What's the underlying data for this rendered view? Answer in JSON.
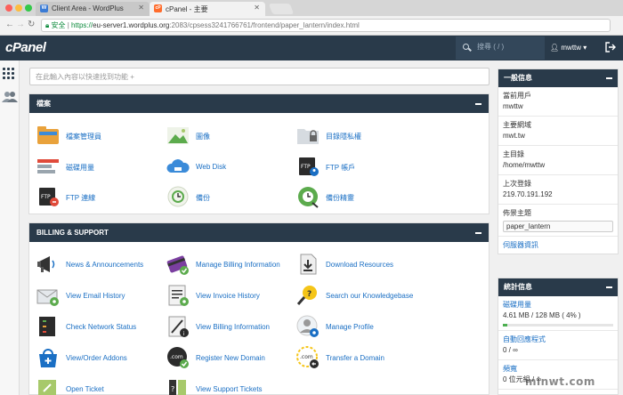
{
  "browser": {
    "tabs": [
      {
        "title": "Client Area - WordPlus",
        "active": false,
        "favicon": "W"
      },
      {
        "title": "cPanel - 主要",
        "active": true,
        "favicon": "cP"
      }
    ],
    "secure_label": "安全",
    "url_scheme": "https://",
    "url_host": "eu-server1.wordplus.org",
    "url_path": ":2083/cpsess3241766761/frontend/paper_lantern/index.html"
  },
  "header": {
    "logo": "cPanel",
    "search_placeholder": "搜尋 ( / )",
    "username": "mwttw"
  },
  "main": {
    "search_placeholder": "在此輸入內容以快速找到功能 +",
    "files": {
      "title": "檔案",
      "items": [
        {
          "label": "檔案管理員",
          "icon": "file-manager-icon"
        },
        {
          "label": "圖像",
          "icon": "images-icon"
        },
        {
          "label": "目錄隱私權",
          "icon": "directory-privacy-icon"
        },
        {
          "label": "磁碟用量",
          "icon": "disk-usage-icon"
        },
        {
          "label": "Web Disk",
          "icon": "web-disk-icon"
        },
        {
          "label": "FTP 帳戶",
          "icon": "ftp-accounts-icon"
        },
        {
          "label": "FTP 連線",
          "icon": "ftp-connections-icon"
        },
        {
          "label": "備份",
          "icon": "backup-icon"
        },
        {
          "label": "備份精靈",
          "icon": "backup-wizard-icon"
        }
      ]
    },
    "billing": {
      "title": "BILLING & SUPPORT",
      "items": [
        {
          "label": "News & Announcements",
          "icon": "megaphone-icon"
        },
        {
          "label": "Manage Billing Information",
          "icon": "credit-card-icon"
        },
        {
          "label": "Download Resources",
          "icon": "download-icon"
        },
        {
          "label": "View Email History",
          "icon": "email-history-icon"
        },
        {
          "label": "View Invoice History",
          "icon": "invoice-icon"
        },
        {
          "label": "Search our Knowledgebase",
          "icon": "knowledgebase-icon"
        },
        {
          "label": "Check Network Status",
          "icon": "network-status-icon"
        },
        {
          "label": "View Billing Information",
          "icon": "billing-info-icon"
        },
        {
          "label": "Manage Profile",
          "icon": "profile-icon"
        },
        {
          "label": "View/Order Addons",
          "icon": "addons-icon"
        },
        {
          "label": "Register New Domain",
          "icon": "register-domain-icon"
        },
        {
          "label": "Transfer a Domain",
          "icon": "transfer-domain-icon"
        },
        {
          "label": "Open Ticket",
          "icon": "open-ticket-icon"
        },
        {
          "label": "View Support Tickets",
          "icon": "support-tickets-icon"
        }
      ]
    }
  },
  "general_info": {
    "title": "一般信息",
    "rows": [
      {
        "key": "當前用戶",
        "value": "mwttw"
      },
      {
        "key": "主要網域",
        "value": "mwt.tw"
      },
      {
        "key": "主目錄",
        "value": "/home/mwttw"
      },
      {
        "key": "上次登錄",
        "value": "219.70.191.192"
      }
    ],
    "theme_label": "佈景主題",
    "theme_value": "paper_lantern",
    "server_info_link": "伺服器資訊"
  },
  "stats": {
    "title": "統計信息",
    "disk_label": "磁碟用量",
    "disk_value": "4.61 MB / 128 MB ( 4% )",
    "disk_percent": 4,
    "autoresponders_label": "自動回應程式",
    "autoresponders_value": "0 / ∞",
    "bandwidth_label": "頻寬",
    "bandwidth_value": "0 位元組 / ∞"
  },
  "watermark": "minwt.com",
  "colors": {
    "header_bg": "#293a4a",
    "link": "#1a6fc4",
    "secure": "#0a8a3a"
  }
}
